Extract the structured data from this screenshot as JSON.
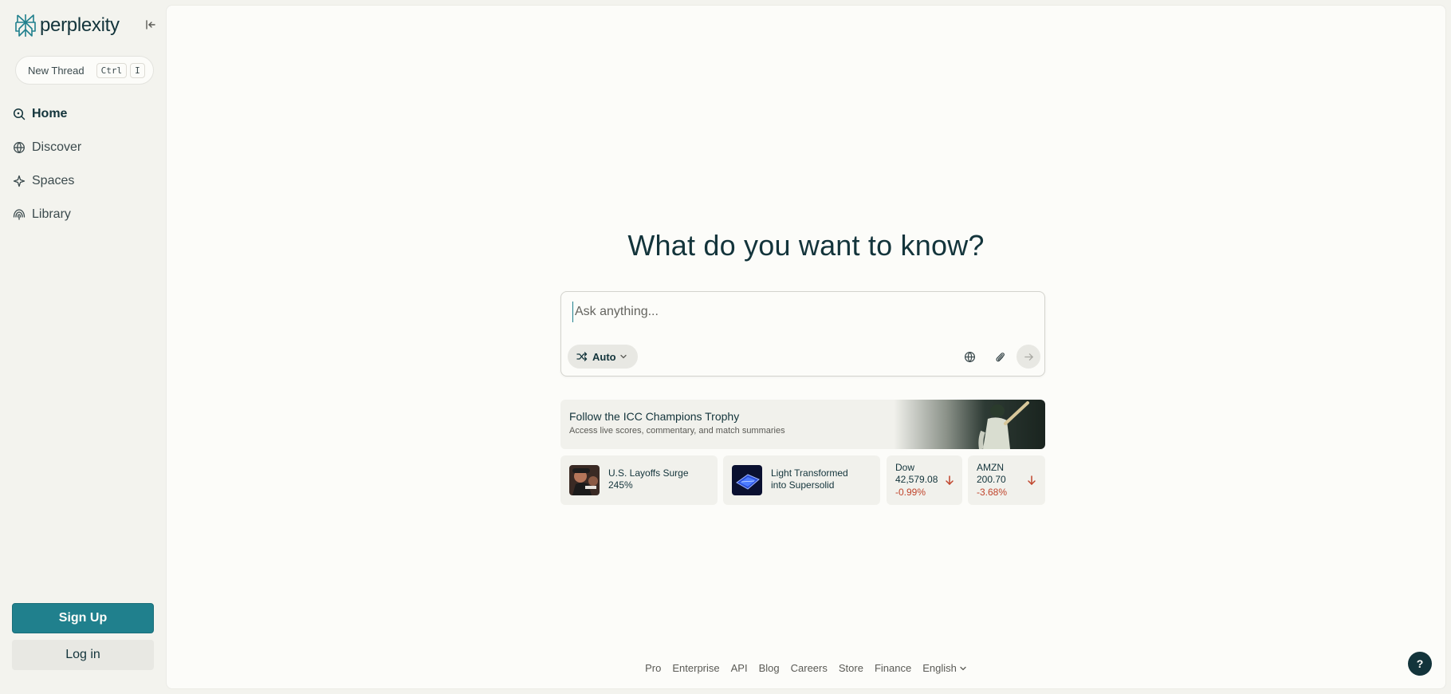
{
  "brand": {
    "name": "perplexity"
  },
  "sidebar": {
    "new_thread": {
      "label": "New Thread",
      "shortcut": [
        "Ctrl",
        "I"
      ]
    },
    "items": [
      {
        "label": "Home",
        "icon": "home-search-icon",
        "active": true
      },
      {
        "label": "Discover",
        "icon": "globe-icon",
        "active": false
      },
      {
        "label": "Spaces",
        "icon": "sparkle-icon",
        "active": false
      },
      {
        "label": "Library",
        "icon": "library-icon",
        "active": false
      }
    ],
    "signup_label": "Sign Up",
    "login_label": "Log in"
  },
  "main": {
    "title": "What do you want to know?",
    "search": {
      "placeholder": "Ask anything...",
      "value": "",
      "mode": "Auto"
    },
    "promo": {
      "title": "Follow the ICC Champions Trophy",
      "subtitle": "Access live scores, commentary, and match summaries"
    },
    "cards": [
      {
        "text": "U.S. Layoffs Surge 245%",
        "thumb": "protest-photo"
      },
      {
        "text": "Light Transformed into Supersolid",
        "thumb": "laser-chip-photo"
      }
    ],
    "stocks": [
      {
        "name": "Dow",
        "value": "42,579.08",
        "change": "-0.99%",
        "direction": "down"
      },
      {
        "name": "AMZN",
        "value": "200.70",
        "change": "-3.68%",
        "direction": "down"
      }
    ]
  },
  "footer": {
    "links": [
      "Pro",
      "Enterprise",
      "API",
      "Blog",
      "Careers",
      "Store",
      "Finance"
    ],
    "language": "English"
  },
  "help_label": "?",
  "colors": {
    "accent": "#20808d",
    "text": "#13343b",
    "negative": "#c0442b",
    "background": "#fcfcf9"
  }
}
